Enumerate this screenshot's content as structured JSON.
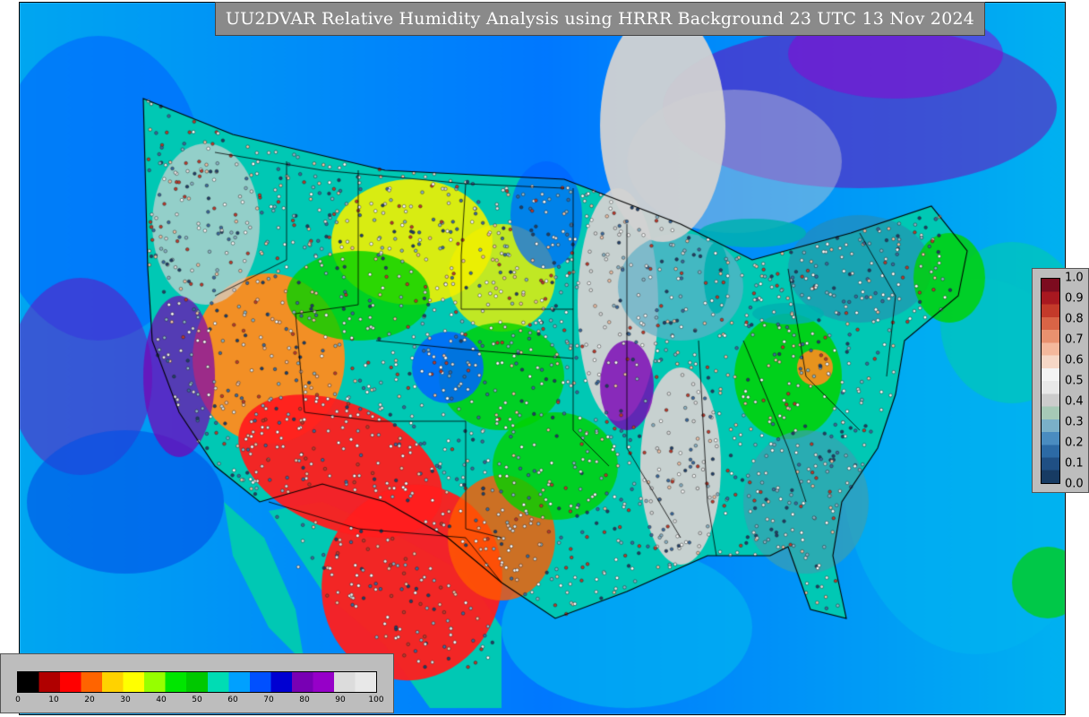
{
  "title": "UU2DVAR Relative Humidity Analysis using HRRR Background 23 UTC 13 Nov 2024",
  "rh_colorbar": {
    "ticks": [
      "0",
      "10",
      "20",
      "30",
      "40",
      "50",
      "60",
      "70",
      "80",
      "90",
      "100"
    ],
    "stops": [
      "#000000",
      "#b00000",
      "#ff0000",
      "#ff6400",
      "#ffd200",
      "#ffff00",
      "#96ff00",
      "#00e600",
      "#00c800",
      "#00dcb4",
      "#00a0ff",
      "#0050ff",
      "#0000d2",
      "#7800b4",
      "#9600c8",
      "#dcdcdc",
      "#e8e8e8"
    ]
  },
  "increment_colorbar": {
    "ticks": [
      "0.0",
      "0.1",
      "0.2",
      "0.3",
      "0.4",
      "0.5",
      "0.6",
      "0.7",
      "0.8",
      "0.9",
      "1.0"
    ],
    "stops": [
      "#173b63",
      "#1f4f84",
      "#2c6aa5",
      "#4a8cc0",
      "#7ab0c8",
      "#a6c9b6",
      "#cccccc",
      "#e8e8e8",
      "#f4f4f4",
      "#f6d7c6",
      "#f4b89c",
      "#e8916f",
      "#d96446",
      "#c43a2a",
      "#a81820",
      "#7c0b1f"
    ]
  },
  "map_colors": {
    "very_dry": "#ff1e1e",
    "dry": "#ff8c1e",
    "moderate": "#f0f000",
    "semi_moist": "#00d200",
    "moist": "#00c8b4",
    "humid": "#0064ff",
    "very_humid": "#7800b4",
    "saturated": "#d2d2d2",
    "ocean": "#00b4f0"
  }
}
